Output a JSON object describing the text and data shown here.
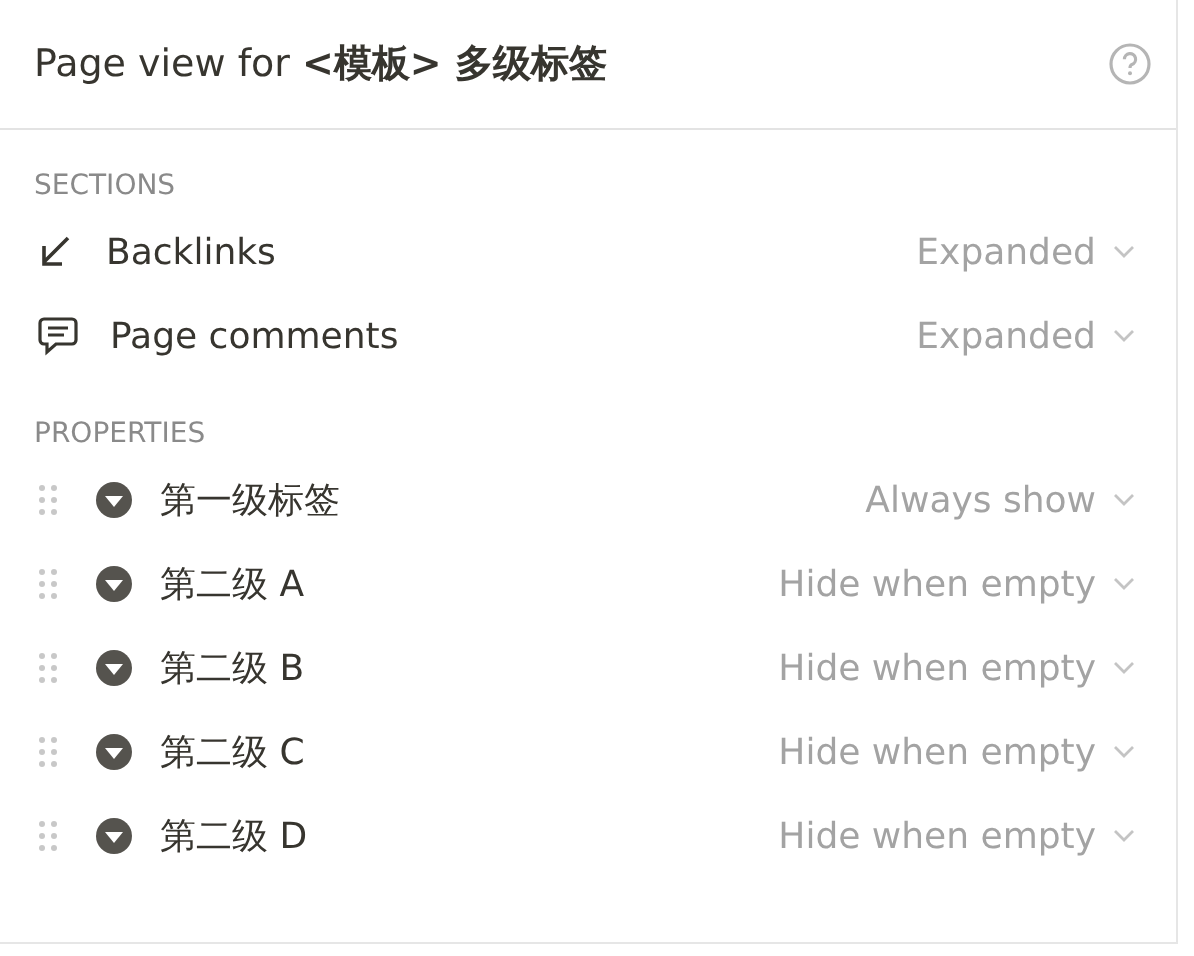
{
  "header": {
    "title": "Page view for **<模板> 多级标签**"
  },
  "sections": {
    "heading": "SECTIONS",
    "items": [
      {
        "kind": "backlinks",
        "label": "Backlinks",
        "value": "Expanded"
      },
      {
        "kind": "comments",
        "label": "Page comments",
        "value": "Expanded"
      }
    ]
  },
  "properties": {
    "heading": "PROPERTIES",
    "items": [
      {
        "kind": "select",
        "label": "第一级标签",
        "value": "Always show"
      },
      {
        "kind": "select",
        "label": "第二级 A",
        "value": "Hide when empty"
      },
      {
        "kind": "select",
        "label": "第二级 B",
        "value": "Hide when empty"
      },
      {
        "kind": "select",
        "label": "第二级 C",
        "value": "Hide when empty"
      },
      {
        "kind": "select",
        "label": "第二级 D",
        "value": "Hide when empty"
      }
    ]
  }
}
